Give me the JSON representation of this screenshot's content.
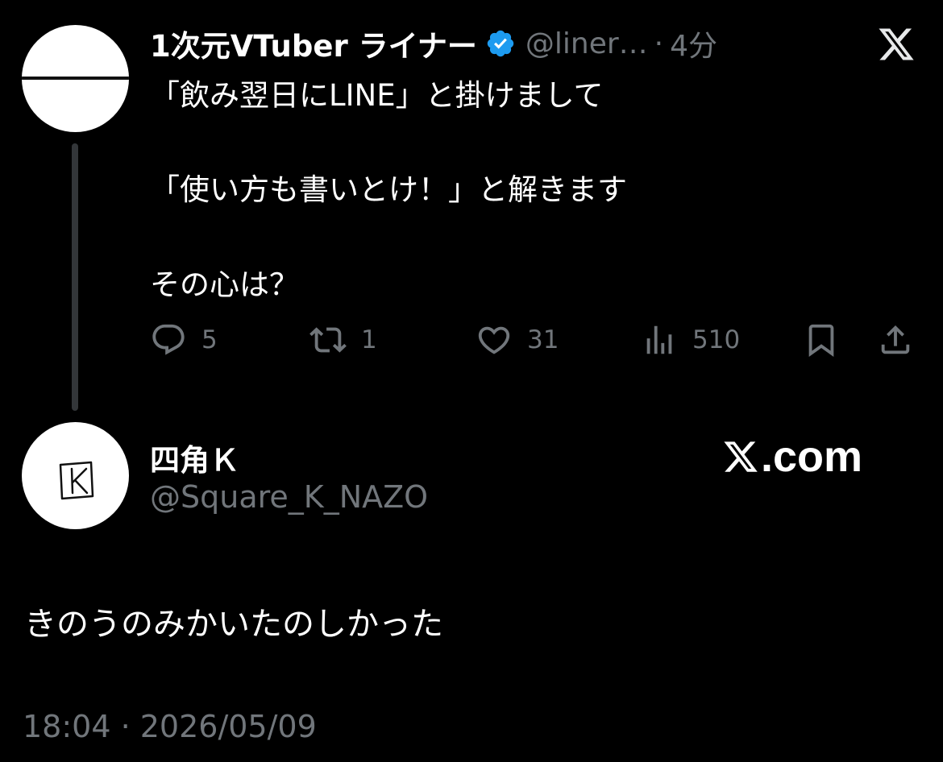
{
  "tweet": {
    "display_name": "1次元VTuber ライナー",
    "handle": "@liner…",
    "separator": "·",
    "time_ago": "4分",
    "lines": [
      "「飲み翌日にLINE」と掛けまして",
      "「使い方も書いとけ！」と解きます",
      "その心は？"
    ],
    "actions": {
      "replies": "5",
      "retweets": "1",
      "likes": "31",
      "views": "510"
    }
  },
  "reply": {
    "display_name": "四角Ｋ",
    "handle": "@Square_K_NAZO",
    "text": "きのうのみかいたのしかった",
    "timestamp": "18:04 · 2026/05/09"
  },
  "watermark": {
    "text": ".com"
  },
  "colors": {
    "background": "#000000",
    "primary_text": "#ffffff",
    "secondary_text": "#71767b",
    "verified_blue": "#1d9bf0",
    "thread_line": "#333639"
  },
  "icons": [
    "x-logo-icon",
    "verified-badge-icon",
    "reply-icon",
    "retweet-icon",
    "like-icon",
    "views-icon",
    "bookmark-icon",
    "share-icon",
    "k-avatar-icon"
  ]
}
